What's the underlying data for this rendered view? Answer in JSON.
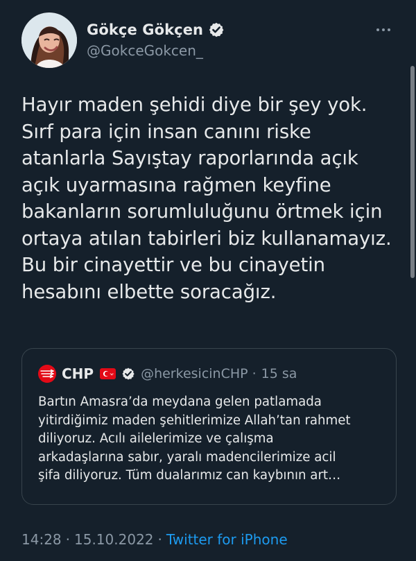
{
  "author": {
    "display_name": "Gökçe Gökçen",
    "handle": "@GokceGokcen_"
  },
  "tweet": {
    "text_lines": [
      "Hayır maden şehidi diye bir şey yok.",
      "Sırf para için insan canını riske",
      "atanlarla Sayıştay raporlarında açık",
      "açık uyarmasına rağmen keyfine",
      "bakanların sorumluluğunu örtmek için",
      "ortaya atılan tabirleri biz kullanamayız.",
      "Bu bir cinayettir ve bu cinayetin",
      "hesabını elbette soracağız."
    ]
  },
  "quoted_tweet": {
    "display_name": "CHP",
    "handle": "@herkesicinCHP",
    "time": "15 sa",
    "text_lines": [
      "Bartın Amasra’da meydana gelen patlamada",
      "yitirdiğimiz maden şehitlerimize Allah’tan rahmet",
      "diliyoruz. Acılı ailelerimize ve çalışma",
      "arkadaşlarına sabır, yaralı madencilerimize acil",
      "şifa diliyoruz. Tüm dualarımız can kaybının art…"
    ]
  },
  "metadata": {
    "time": "14:28",
    "date": "15.10.2022",
    "source": "Twitter for iPhone"
  },
  "colors": {
    "background": "#15202b",
    "primary_text": "#e7e9ea",
    "secondary_text": "#8b98a5",
    "accent": "#1d9bf0",
    "border": "#38444d",
    "chp_red": "#e30a17"
  },
  "icons": {
    "verified": "verified-badge-icon",
    "more": "more-horizontal-icon",
    "flag": "turkey-flag-icon"
  }
}
